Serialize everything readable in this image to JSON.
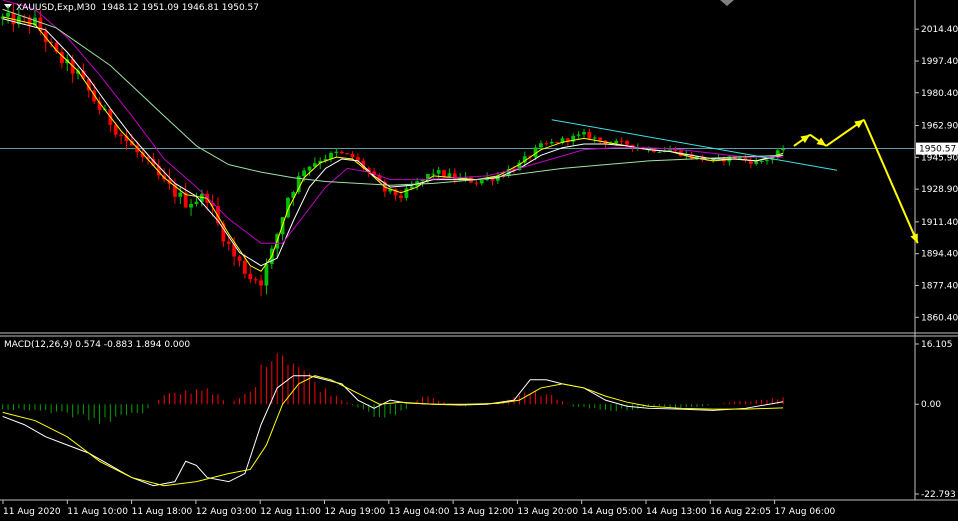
{
  "header": {
    "symbol_label": "XAUUSD,Exp,M30",
    "ohlc_label": "1948.12 1951.09 1946.81 1950.57"
  },
  "macd": {
    "label": "MACD(12,26,9) 0.574 -0.883 1.894 0.000"
  },
  "colors": {
    "background": "#000000",
    "frame": "#c0c0c0",
    "bull_candle": "#00c000",
    "bear_candle": "#ff0000",
    "ma_fast": "#ffff00",
    "ma_mid": "#ffffff",
    "ma_slow1": "#c000c0",
    "ma_slow2": "#a0e0a0",
    "trendline": "#40e0e0",
    "price_line": "#80d0e0",
    "forecast_arrows": "#ffff00",
    "macd_main": "#ffffff",
    "macd_signal": "#ffff00",
    "hist_pos": "#ff0000",
    "hist_neg": "#00a000"
  },
  "chart_data": [
    {
      "type": "candlestick",
      "title": "XAUUSD,Exp,M30",
      "ylim": [
        1852,
        2030
      ],
      "y_ticks": [
        "2014.40",
        "1997.40",
        "1980.40",
        "1962.90",
        "1945.90",
        "1928.90",
        "1911.40",
        "1894.40",
        "1877.40",
        "1860.40"
      ],
      "current_price": "1950.57",
      "x_ticks": [
        "11 Aug 2020",
        "11 Aug 10:00",
        "11 Aug 18:00",
        "12 Aug 03:00",
        "12 Aug 11:00",
        "12 Aug 19:00",
        "13 Aug 04:00",
        "13 Aug 12:00",
        "13 Aug 20:00",
        "14 Aug 05:00",
        "14 Aug 13:00",
        "16 Aug 22:05",
        "17 Aug 06:00"
      ],
      "close_path": [
        [
          0,
          2020
        ],
        [
          6,
          2018
        ],
        [
          10,
          2000
        ],
        [
          14,
          1990
        ],
        [
          18,
          1972
        ],
        [
          22,
          1958
        ],
        [
          26,
          1945
        ],
        [
          30,
          1932
        ],
        [
          34,
          1922
        ],
        [
          38,
          1925
        ],
        [
          40,
          1910
        ],
        [
          43,
          1893
        ],
        [
          46,
          1882
        ],
        [
          48,
          1880
        ],
        [
          50,
          1895
        ],
        [
          53,
          1925
        ],
        [
          56,
          1940
        ],
        [
          59,
          1945
        ],
        [
          62,
          1948
        ],
        [
          65,
          1946
        ],
        [
          68,
          1938
        ],
        [
          71,
          1928
        ],
        [
          74,
          1925
        ],
        [
          77,
          1932
        ],
        [
          80,
          1938
        ],
        [
          84,
          1935
        ],
        [
          88,
          1933
        ],
        [
          92,
          1936
        ],
        [
          96,
          1942
        ],
        [
          100,
          1952
        ],
        [
          104,
          1955
        ],
        [
          108,
          1958
        ],
        [
          112,
          1954
        ],
        [
          116,
          1953
        ],
        [
          120,
          1950
        ],
        [
          124,
          1950
        ],
        [
          128,
          1946
        ],
        [
          132,
          1944
        ],
        [
          136,
          1946
        ],
        [
          140,
          1943
        ],
        [
          143,
          1946
        ],
        [
          145,
          1950.57
        ]
      ],
      "moving_averages": [
        {
          "role": "fast",
          "path": [
            [
              0,
              2021
            ],
            [
              6,
              2017
            ],
            [
              10,
              2003
            ],
            [
              14,
              1992
            ],
            [
              18,
              1975
            ],
            [
              22,
              1960
            ],
            [
              26,
              1948
            ],
            [
              30,
              1935
            ],
            [
              34,
              1926
            ],
            [
              38,
              1924
            ],
            [
              42,
              1905
            ],
            [
              46,
              1888
            ],
            [
              48,
              1885
            ],
            [
              50,
              1893
            ],
            [
              53,
              1918
            ],
            [
              56,
              1935
            ],
            [
              59,
              1943
            ],
            [
              62,
              1946
            ],
            [
              65,
              1945
            ],
            [
              68,
              1938
            ],
            [
              71,
              1930
            ],
            [
              74,
              1927
            ],
            [
              77,
              1930
            ],
            [
              80,
              1936
            ],
            [
              84,
              1935
            ],
            [
              88,
              1934
            ],
            [
              92,
              1936
            ],
            [
              96,
              1942
            ],
            [
              100,
              1950
            ],
            [
              104,
              1954
            ],
            [
              108,
              1956
            ],
            [
              112,
              1954
            ],
            [
              116,
              1952
            ],
            [
              120,
              1950
            ],
            [
              124,
              1949
            ],
            [
              128,
              1946
            ],
            [
              132,
              1944
            ],
            [
              136,
              1945
            ],
            [
              140,
              1944
            ],
            [
              145,
              1948
            ]
          ]
        },
        {
          "role": "mid",
          "path": [
            [
              0,
              2020
            ],
            [
              8,
              2014
            ],
            [
              12,
              2002
            ],
            [
              16,
              1988
            ],
            [
              20,
              1972
            ],
            [
              24,
              1957
            ],
            [
              28,
              1944
            ],
            [
              32,
              1932
            ],
            [
              36,
              1925
            ],
            [
              40,
              1912
            ],
            [
              44,
              1895
            ],
            [
              48,
              1888
            ],
            [
              51,
              1892
            ],
            [
              54,
              1912
            ],
            [
              57,
              1930
            ],
            [
              60,
              1940
            ],
            [
              63,
              1945
            ],
            [
              66,
              1944
            ],
            [
              69,
              1936
            ],
            [
              72,
              1930
            ],
            [
              76,
              1931
            ],
            [
              80,
              1934
            ],
            [
              84,
              1934
            ],
            [
              88,
              1934
            ],
            [
              92,
              1935
            ],
            [
              96,
              1940
            ],
            [
              100,
              1947
            ],
            [
              104,
              1951
            ],
            [
              108,
              1953
            ],
            [
              112,
              1953
            ],
            [
              116,
              1952
            ],
            [
              120,
              1950
            ],
            [
              124,
              1949
            ],
            [
              128,
              1947
            ],
            [
              132,
              1945
            ],
            [
              136,
              1945
            ],
            [
              140,
              1944
            ],
            [
              145,
              1947
            ]
          ]
        },
        {
          "role": "slow1",
          "path": [
            [
              0,
              2030
            ],
            [
              6,
              2025
            ],
            [
              12,
              2010
            ],
            [
              18,
              1990
            ],
            [
              24,
              1968
            ],
            [
              30,
              1945
            ],
            [
              36,
              1930
            ],
            [
              42,
              1913
            ],
            [
              48,
              1900
            ],
            [
              52,
              1900
            ],
            [
              56,
              1915
            ],
            [
              60,
              1930
            ],
            [
              64,
              1940
            ],
            [
              68,
              1938
            ],
            [
              72,
              1934
            ],
            [
              78,
              1934
            ],
            [
              84,
              1935
            ],
            [
              90,
              1936
            ],
            [
              96,
              1940
            ],
            [
              102,
              1945
            ],
            [
              108,
              1950
            ],
            [
              114,
              1951
            ],
            [
              120,
              1951
            ],
            [
              126,
              1950
            ],
            [
              132,
              1948
            ],
            [
              138,
              1946
            ],
            [
              145,
              1946
            ]
          ]
        },
        {
          "role": "slow2",
          "path": [
            [
              0,
              2025
            ],
            [
              10,
              2015
            ],
            [
              20,
              1995
            ],
            [
              30,
              1968
            ],
            [
              36,
              1952
            ],
            [
              42,
              1942
            ],
            [
              48,
              1938
            ],
            [
              54,
              1935
            ],
            [
              60,
              1933
            ],
            [
              66,
              1932
            ],
            [
              72,
              1931
            ],
            [
              80,
              1932
            ],
            [
              88,
              1934
            ],
            [
              96,
              1937
            ],
            [
              104,
              1940
            ],
            [
              112,
              1942
            ],
            [
              120,
              1944
            ],
            [
              128,
              1945
            ],
            [
              136,
              1946
            ],
            [
              145,
              1947
            ]
          ]
        }
      ],
      "trendline": {
        "from": [
          102,
          1966
        ],
        "to": [
          155,
          1939
        ]
      },
      "forecast_path": [
        [
          147,
          1952
        ],
        [
          150,
          1958
        ],
        [
          153,
          1952
        ],
        [
          160,
          1966
        ],
        [
          170,
          1900
        ]
      ]
    },
    {
      "type": "histogram_line",
      "title": "MACD(12,26,9) 0.574 -0.883 1.894 0.000",
      "ylim": [
        -23.5,
        16.5
      ],
      "y_ticks": [
        "16.105",
        "0.00",
        "-22.793"
      ],
      "hist_path": [
        [
          0,
          -1
        ],
        [
          6,
          -1.5
        ],
        [
          10,
          -2
        ],
        [
          14,
          -3
        ],
        [
          18,
          -4
        ],
        [
          22,
          -3
        ],
        [
          26,
          -2
        ],
        [
          30,
          2
        ],
        [
          34,
          3
        ],
        [
          38,
          4
        ],
        [
          42,
          0
        ],
        [
          46,
          3
        ],
        [
          48,
          8
        ],
        [
          50,
          14
        ],
        [
          53,
          12
        ],
        [
          56,
          8
        ],
        [
          59,
          4
        ],
        [
          62,
          2
        ],
        [
          66,
          -1
        ],
        [
          70,
          -3
        ],
        [
          74,
          -2
        ],
        [
          78,
          2
        ],
        [
          82,
          0.5
        ],
        [
          86,
          -0.5
        ],
        [
          90,
          0.3
        ],
        [
          94,
          1
        ],
        [
          98,
          3
        ],
        [
          102,
          2
        ],
        [
          106,
          -0.5
        ],
        [
          110,
          -1
        ],
        [
          114,
          -1.5
        ],
        [
          118,
          -1
        ],
        [
          122,
          -0.5
        ],
        [
          126,
          -1
        ],
        [
          130,
          -0.5
        ],
        [
          134,
          0.3
        ],
        [
          138,
          0.8
        ],
        [
          142,
          1
        ],
        [
          145,
          1.9
        ]
      ],
      "main_path": [
        [
          0,
          -3
        ],
        [
          4,
          -5
        ],
        [
          8,
          -8
        ],
        [
          12,
          -10
        ],
        [
          16,
          -12
        ],
        [
          20,
          -15
        ],
        [
          24,
          -18
        ],
        [
          28,
          -20
        ],
        [
          32,
          -19
        ],
        [
          34,
          -14
        ],
        [
          36,
          -15
        ],
        [
          38,
          -18
        ],
        [
          42,
          -19
        ],
        [
          45,
          -17
        ],
        [
          48,
          -5
        ],
        [
          51,
          4
        ],
        [
          54,
          7
        ],
        [
          57,
          7
        ],
        [
          60,
          6
        ],
        [
          63,
          5
        ],
        [
          66,
          1
        ],
        [
          69,
          -1
        ],
        [
          72,
          1
        ],
        [
          75,
          0.3
        ],
        [
          80,
          0
        ],
        [
          85,
          -0.2
        ],
        [
          90,
          0
        ],
        [
          95,
          1
        ],
        [
          98,
          6
        ],
        [
          101,
          6
        ],
        [
          104,
          5
        ],
        [
          108,
          4
        ],
        [
          112,
          1
        ],
        [
          116,
          -0.5
        ],
        [
          120,
          -1
        ],
        [
          126,
          -1.2
        ],
        [
          132,
          -1.5
        ],
        [
          138,
          -1
        ],
        [
          145,
          0.6
        ]
      ],
      "signal_path": [
        [
          0,
          -2
        ],
        [
          6,
          -4
        ],
        [
          12,
          -8
        ],
        [
          18,
          -14
        ],
        [
          24,
          -18
        ],
        [
          30,
          -20
        ],
        [
          36,
          -19
        ],
        [
          42,
          -17
        ],
        [
          46,
          -16
        ],
        [
          49,
          -10
        ],
        [
          52,
          0
        ],
        [
          55,
          5
        ],
        [
          58,
          7
        ],
        [
          61,
          6
        ],
        [
          64,
          4
        ],
        [
          67,
          2
        ],
        [
          70,
          0
        ],
        [
          74,
          0.5
        ],
        [
          80,
          0
        ],
        [
          86,
          0
        ],
        [
          92,
          0.2
        ],
        [
          96,
          1
        ],
        [
          100,
          4
        ],
        [
          104,
          5
        ],
        [
          108,
          4
        ],
        [
          112,
          2
        ],
        [
          116,
          0.5
        ],
        [
          120,
          -0.5
        ],
        [
          126,
          -1
        ],
        [
          132,
          -1.2
        ],
        [
          138,
          -1.2
        ],
        [
          145,
          -0.9
        ]
      ]
    }
  ]
}
